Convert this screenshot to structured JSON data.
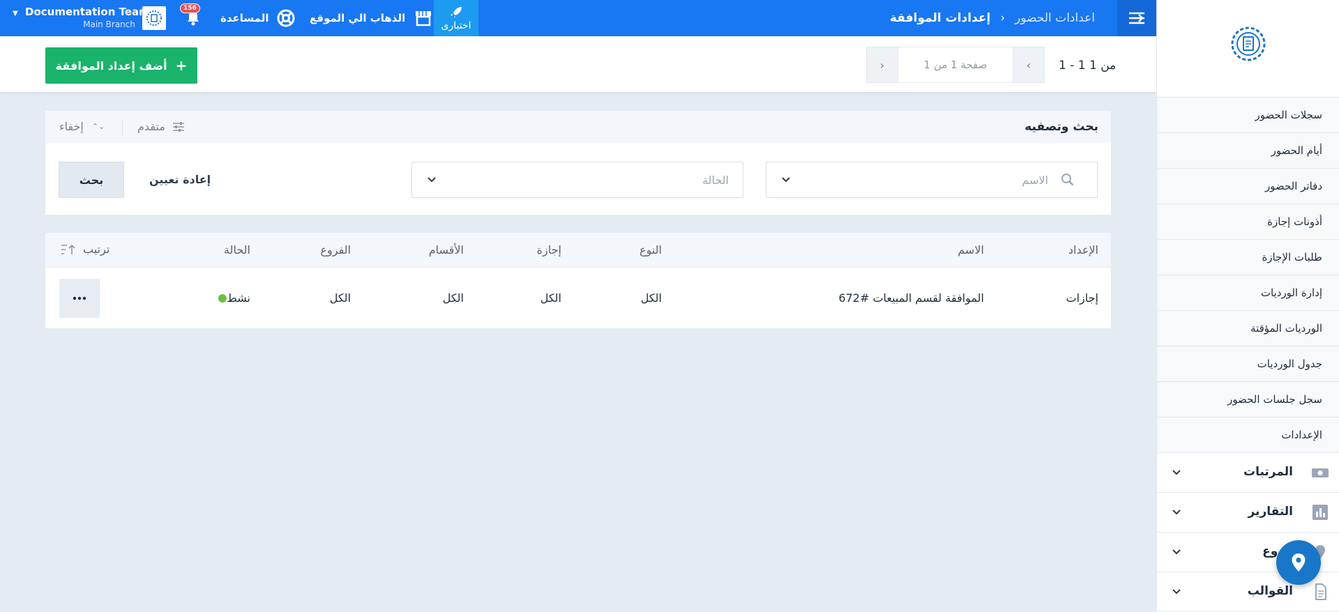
{
  "header": {
    "user_name": "Documentation Team",
    "user_branch": "Main Branch",
    "notification_count": "156",
    "help_label": "المساعدة",
    "go_to_site_label": "الذهاب الي الموقع",
    "test_label": "اختبارى",
    "breadcrumb_parent": "اعدادات الحضور",
    "breadcrumb_current": "إعدادات الموافقة"
  },
  "toolbar": {
    "add_button_label": "أضف إعداد الموافقة",
    "pagination_range": "1 - 1 من 1",
    "pagination_page": "صفحة 1 من 1"
  },
  "search_panel": {
    "title": "بحث وتصفيه",
    "advanced_label": "متقدم",
    "hide_label": "إخفاء",
    "name_placeholder": "الاسم",
    "status_placeholder": "الحالة",
    "reset_label": "إعادة تعيين",
    "search_label": "بحث"
  },
  "table": {
    "headers": {
      "setting": "الإعداد",
      "name": "الاسم",
      "type": "النوع",
      "leave": "إجازة",
      "departments": "الأقسام",
      "branches": "الفروع",
      "status": "الحالة",
      "sort": "ترتيب"
    },
    "rows": [
      {
        "setting": "إجازات",
        "name": "الموافقة لقسم المبيعات #672",
        "type": "الكل",
        "leave": "الكل",
        "departments": "الكل",
        "branches": "الكل",
        "status": "نشط"
      }
    ]
  },
  "sidebar": {
    "sub_items": [
      "سجلات الحضور",
      "أيام الحضور",
      "دفاتر الحضور",
      "أذونات إجازة",
      "طلبات الإجازة",
      "إدارة الورديات",
      "الورديات المؤقتة",
      "جدول الورديات",
      "سجل جلسات الحضور",
      "الإعدادات"
    ],
    "main_items": [
      "المرتبات",
      "التقارير",
      "فروع",
      "القوالب"
    ]
  },
  "colors": {
    "primary": "#1877f2",
    "success": "#19b36b",
    "active_status": "#6ac13f",
    "badge": "#ef4d56"
  }
}
